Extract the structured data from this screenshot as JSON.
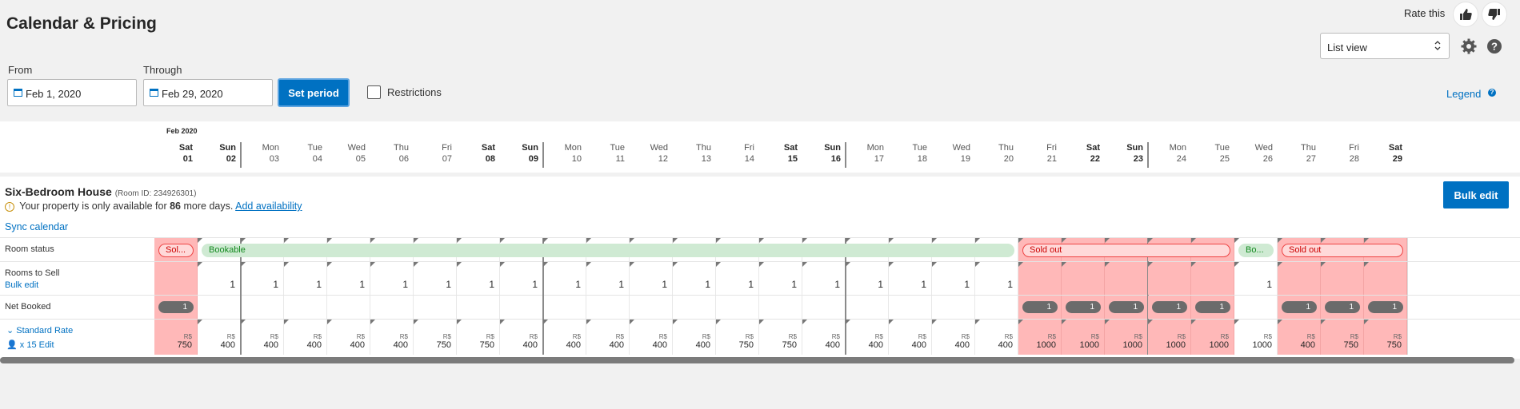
{
  "header": {
    "title": "Calendar & Pricing",
    "rate_label": "Rate this",
    "view_select": "List view"
  },
  "period": {
    "from_label": "From",
    "from_value": "Feb 1, 2020",
    "through_label": "Through",
    "through_value": "Feb 29, 2020",
    "set_period_label": "Set period",
    "restrictions_label": "Restrictions",
    "legend_label": "Legend"
  },
  "calendar": {
    "month": "Feb 2020",
    "days": [
      {
        "dow": "Sat",
        "num": "01"
      },
      {
        "dow": "Sun",
        "num": "02"
      },
      {
        "dow": "Mon",
        "num": "03"
      },
      {
        "dow": "Tue",
        "num": "04"
      },
      {
        "dow": "Wed",
        "num": "05"
      },
      {
        "dow": "Thu",
        "num": "06"
      },
      {
        "dow": "Fri",
        "num": "07"
      },
      {
        "dow": "Sat",
        "num": "08"
      },
      {
        "dow": "Sun",
        "num": "09"
      },
      {
        "dow": "Mon",
        "num": "10"
      },
      {
        "dow": "Tue",
        "num": "11"
      },
      {
        "dow": "Wed",
        "num": "12"
      },
      {
        "dow": "Thu",
        "num": "13"
      },
      {
        "dow": "Fri",
        "num": "14"
      },
      {
        "dow": "Sat",
        "num": "15"
      },
      {
        "dow": "Sun",
        "num": "16"
      },
      {
        "dow": "Mon",
        "num": "17"
      },
      {
        "dow": "Tue",
        "num": "18"
      },
      {
        "dow": "Wed",
        "num": "19"
      },
      {
        "dow": "Thu",
        "num": "20"
      },
      {
        "dow": "Fri",
        "num": "21"
      },
      {
        "dow": "Sat",
        "num": "22"
      },
      {
        "dow": "Sun",
        "num": "23"
      },
      {
        "dow": "Mon",
        "num": "24"
      },
      {
        "dow": "Tue",
        "num": "25"
      },
      {
        "dow": "Wed",
        "num": "26"
      },
      {
        "dow": "Thu",
        "num": "27"
      },
      {
        "dow": "Fri",
        "num": "28"
      },
      {
        "dow": "Sat",
        "num": "29"
      }
    ],
    "status_pills": [
      {
        "label": "Sol...",
        "type": "soldout",
        "from": 0,
        "to": 0
      },
      {
        "label": "Bookable",
        "type": "bookable",
        "from": 1,
        "to": 19
      },
      {
        "label": "Sold out",
        "type": "soldout",
        "from": 20,
        "to": 24
      },
      {
        "label": "Bo...",
        "type": "bookable",
        "from": 25,
        "to": 25
      },
      {
        "label": "Sold out",
        "type": "soldout",
        "from": 26,
        "to": 28
      }
    ],
    "sold_out_days": [
      0,
      20,
      21,
      22,
      23,
      24,
      26,
      27,
      28
    ],
    "rooms_to_sell": [
      "",
      "1",
      "1",
      "1",
      "1",
      "1",
      "1",
      "1",
      "1",
      "1",
      "1",
      "1",
      "1",
      "1",
      "1",
      "1",
      "1",
      "1",
      "1",
      "1",
      "",
      "",
      "",
      "",
      "",
      "1",
      "",
      "",
      ""
    ],
    "net_booked": [
      "1",
      "",
      "",
      "",
      "",
      "",
      "",
      "",
      "",
      "",
      "",
      "",
      "",
      "",
      "",
      "",
      "",
      "",
      "",
      "",
      "1",
      "1",
      "1",
      "1",
      "1",
      "",
      "1",
      "1",
      "1"
    ],
    "currency": "R$",
    "prices": [
      "750",
      "400",
      "400",
      "400",
      "400",
      "400",
      "750",
      "750",
      "400",
      "400",
      "400",
      "400",
      "400",
      "750",
      "750",
      "400",
      "400",
      "400",
      "400",
      "400",
      "1000",
      "1000",
      "1000",
      "1000",
      "1000",
      "1000",
      "400",
      "750",
      "750"
    ]
  },
  "room": {
    "name": "Six-Bedroom House",
    "id_text": "(Room ID: 234926301)",
    "avail_prefix": "Your property is only available for",
    "avail_days": "86",
    "avail_suffix": "more days.",
    "add_availability": "Add availability",
    "sync_calendar": "Sync calendar",
    "bulk_edit_button": "Bulk edit",
    "room_status_label": "Room status",
    "rooms_to_sell_label": "Rooms to Sell",
    "bulk_edit_link": "Bulk edit",
    "net_booked_label": "Net Booked",
    "standard_rate_label": "Standard Rate",
    "occupancy_label": "x 15",
    "edit_label": "Edit"
  }
}
